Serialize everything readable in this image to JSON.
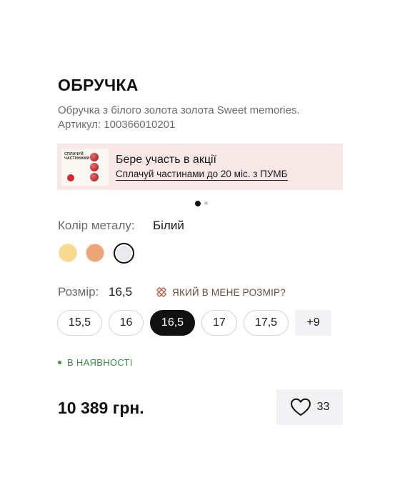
{
  "product": {
    "title": "ОБРУЧКА",
    "description": "Обручка з білого золота золота Sweet memories.",
    "sku": "Артикул: 100366010201"
  },
  "promo": {
    "image_text": "СПЛАЧУЙ ЧАСТИНАМИ",
    "headline": "Бере участь в акції",
    "link": "Сплачуй частинами до 20 міс. з ПУМБ",
    "accent_color": "#d6262b",
    "background_color": "#f7e8e7"
  },
  "carousel": {
    "current": 1,
    "total": 2
  },
  "metal": {
    "label": "Колір металу:",
    "value": "Білий",
    "swatches": [
      {
        "name": "yellow",
        "color": "#f7da8d",
        "selected": false
      },
      {
        "name": "rose",
        "color": "#eda577",
        "selected": false
      },
      {
        "name": "white",
        "color": "#e9e9ee",
        "selected": true
      }
    ]
  },
  "size": {
    "label": "Розмір:",
    "value": "16,5",
    "guide_link": "ЯКИЙ В МЕНЕ РОЗМІР?",
    "options": [
      "15,5",
      "16",
      "16,5",
      "17",
      "17,5"
    ],
    "selected": "16,5",
    "more": "+9"
  },
  "availability": {
    "text": "В НАЯВНОСТІ",
    "color": "#3a8a4a"
  },
  "price": "10 389 грн.",
  "favorite": {
    "icon": "heart-icon",
    "count": "33"
  }
}
